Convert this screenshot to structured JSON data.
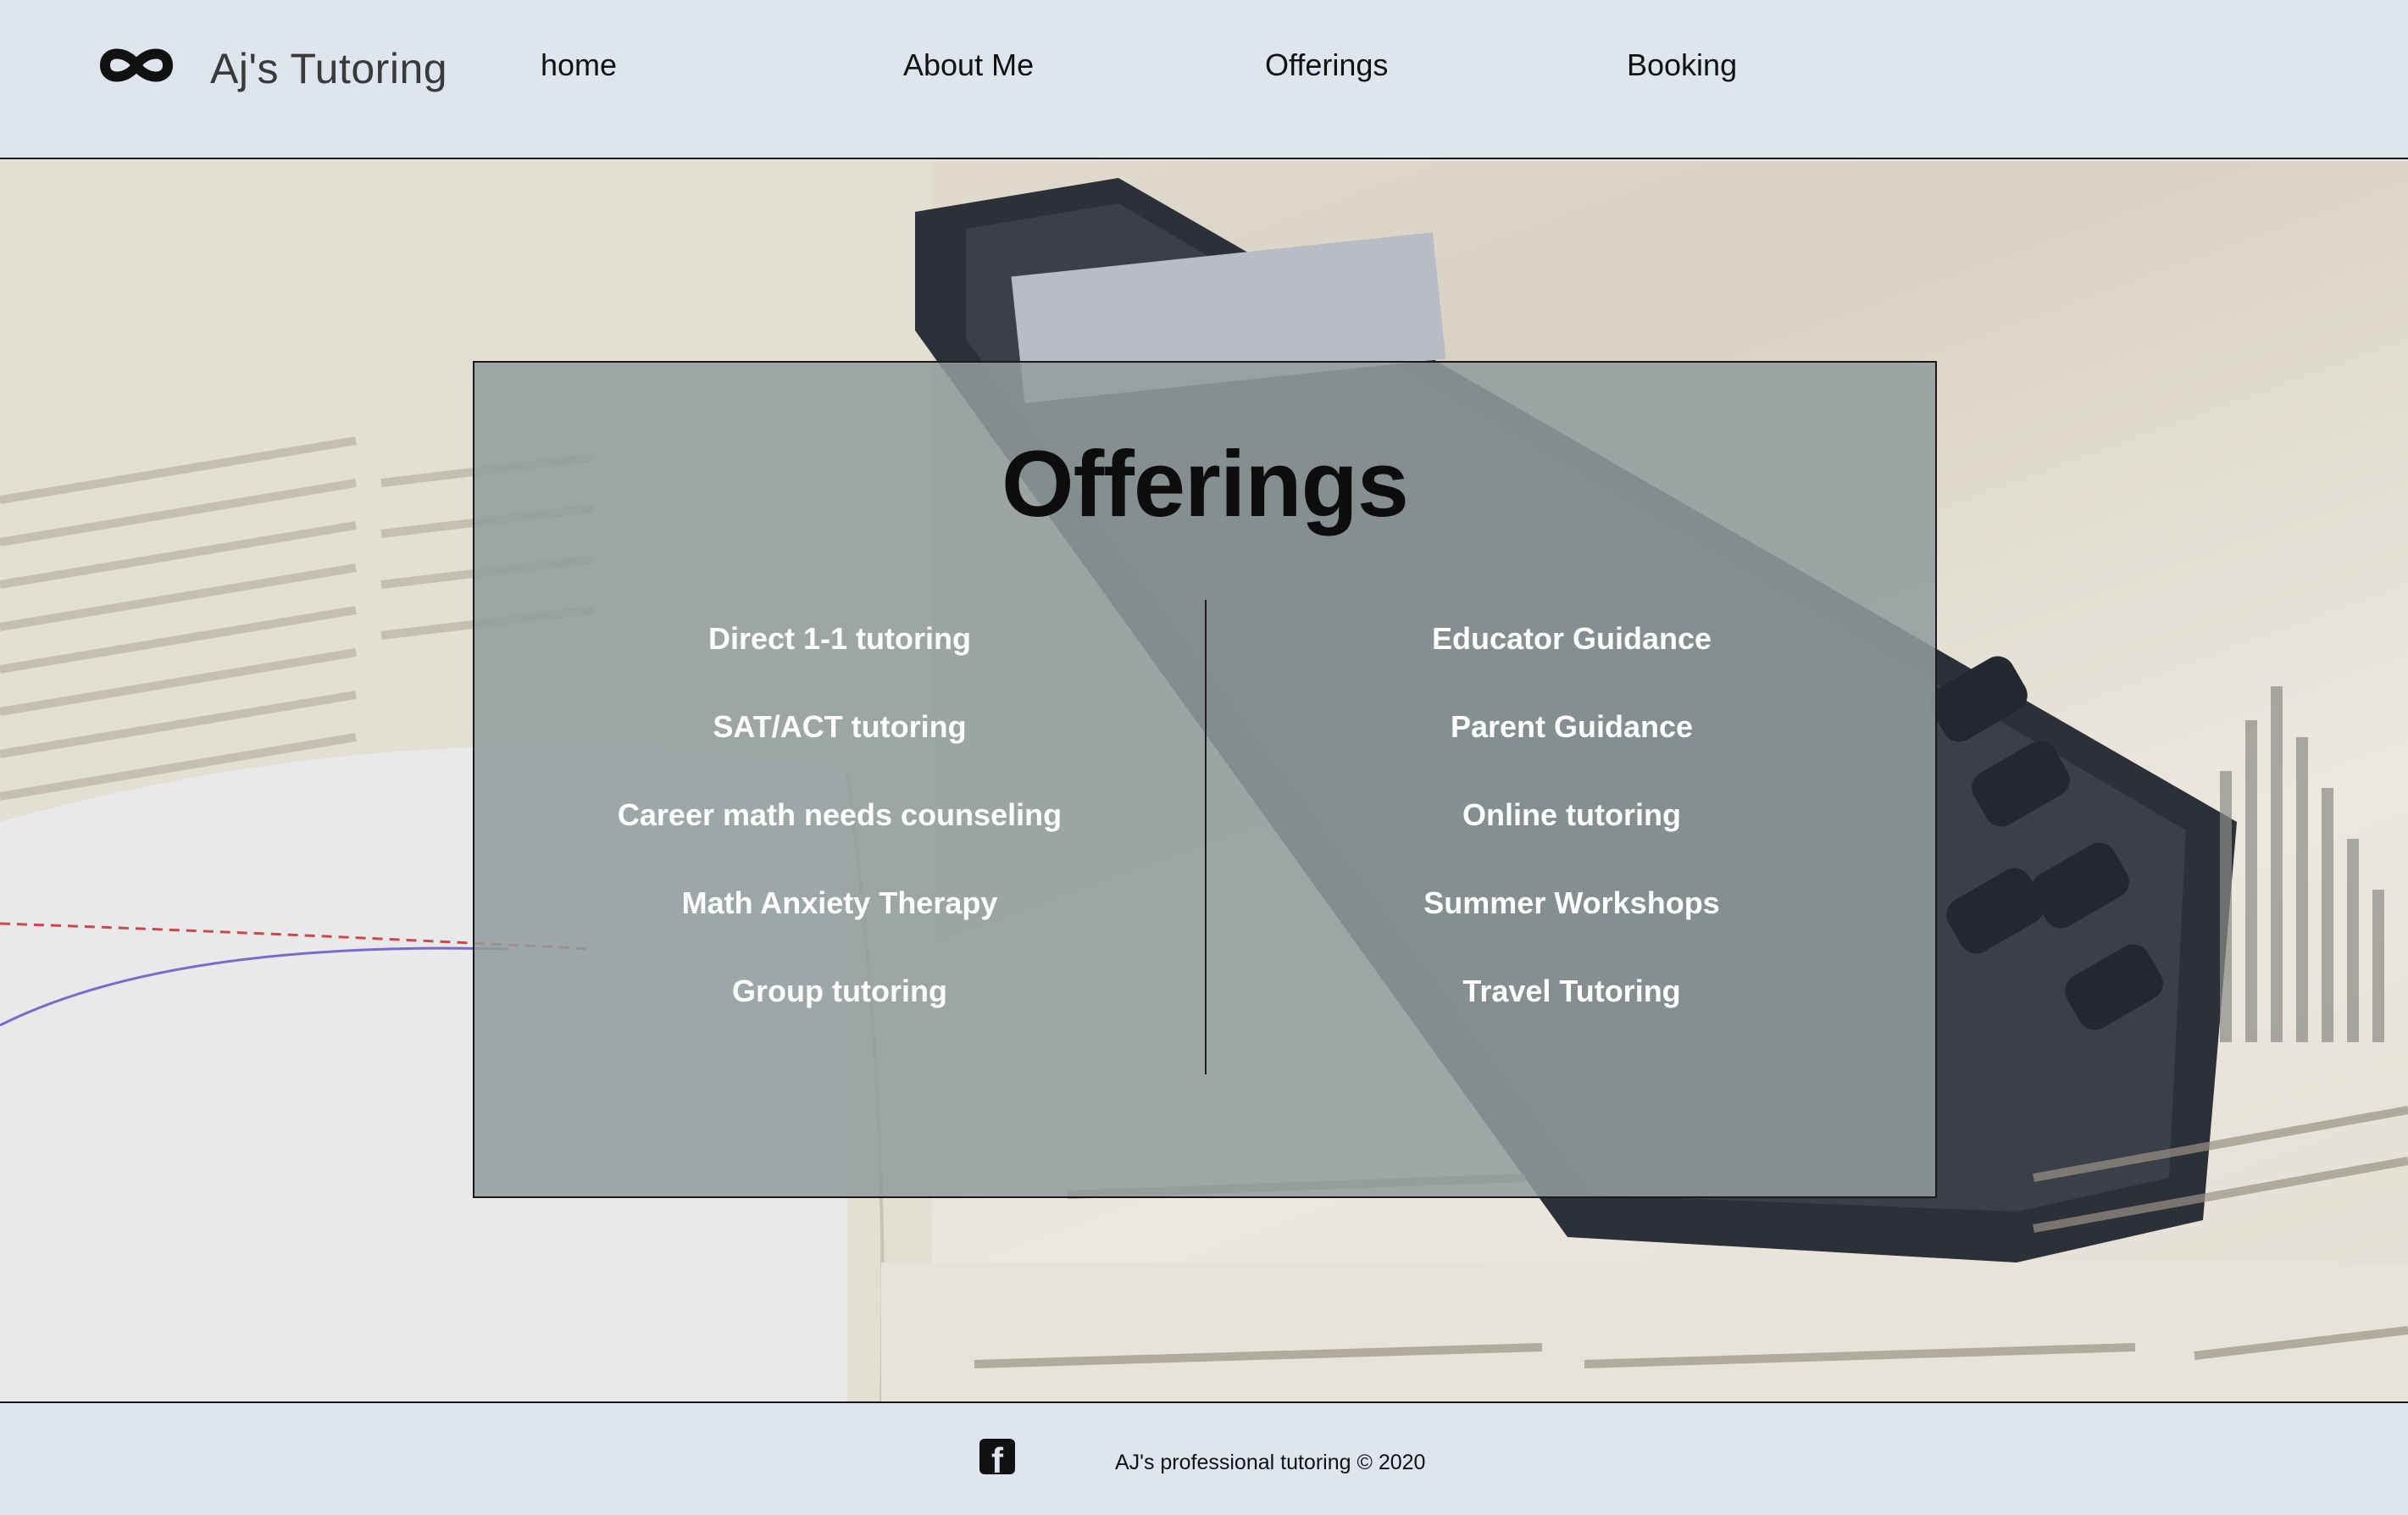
{
  "header": {
    "brand": "Aj's Tutoring",
    "logo_icon": "infinity-icon",
    "nav": [
      {
        "label": "home"
      },
      {
        "label": "About Me"
      },
      {
        "label": "Offerings"
      },
      {
        "label": "Booking"
      }
    ]
  },
  "main": {
    "title": "Offerings",
    "left_offerings": [
      "Direct 1-1 tutoring",
      "SAT/ACT tutoring",
      "Career math needs counseling",
      "Math Anxiety Therapy",
      "Group tutoring"
    ],
    "right_offerings": [
      "Educator Guidance",
      "Parent Guidance",
      "Online tutoring",
      "Summer Workshops",
      "Travel Tutoring"
    ]
  },
  "footer": {
    "social_icon": "facebook-icon",
    "copyright": "AJ's professional tutoring © 2020"
  },
  "colors": {
    "background": "#dfe5ef",
    "panel": "#929c9c",
    "text_dark": "#111111",
    "offer_text": "#ffffff"
  }
}
